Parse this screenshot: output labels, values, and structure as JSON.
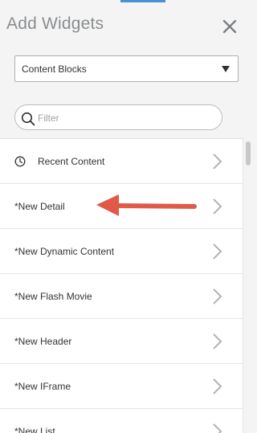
{
  "panel": {
    "title": "Add Widgets",
    "close_icon": "close-icon"
  },
  "category_select": {
    "value": "Content Blocks"
  },
  "filter": {
    "placeholder": "Filter",
    "value": ""
  },
  "widgets": [
    {
      "label": "Recent Content",
      "icon": "clock-icon"
    },
    {
      "label": "*New Detail"
    },
    {
      "label": "*New Dynamic Content"
    },
    {
      "label": "*New Flash Movie"
    },
    {
      "label": "*New Header"
    },
    {
      "label": "*New IFrame"
    },
    {
      "label": "*New List"
    }
  ],
  "annotation": {
    "type": "red-arrow",
    "points_to": "*New Detail",
    "color": "#e05a47"
  },
  "colors": {
    "accent": "#4a90d9",
    "title": "#8a8d90",
    "chevron": "#b0b3b6"
  }
}
